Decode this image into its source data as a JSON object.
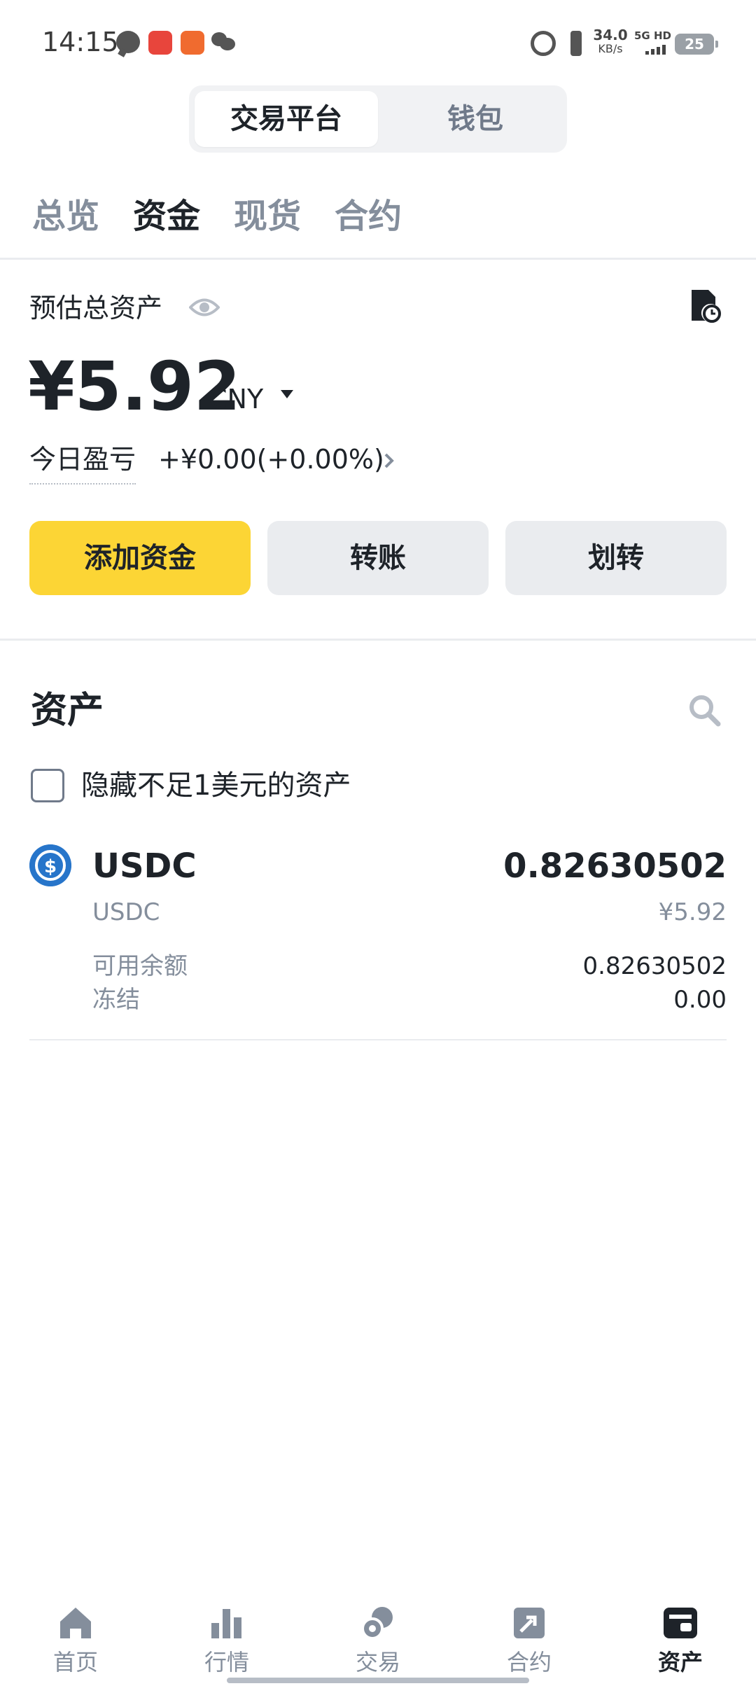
{
  "status_bar": {
    "time": "14:15",
    "net_speed_value": "34.0",
    "net_speed_unit": "KB/s",
    "signal_label": "5G HD",
    "battery": "25"
  },
  "segment": {
    "active": "交易平台",
    "inactive": "钱包"
  },
  "tabs": [
    "总览",
    "资金",
    "现货",
    "合约"
  ],
  "summary": {
    "label": "预估总资产",
    "balance": "¥5.92",
    "currency": "CNY",
    "pnl_label": "今日盈亏",
    "pnl_value": "+¥0.00(+0.00%)"
  },
  "actions": {
    "add_funds": "添加资金",
    "transfer": "转账",
    "move": "划转"
  },
  "assets": {
    "title": "资产",
    "hide_small_label": "隐藏不足1美元的资产",
    "hide_small_checked": false,
    "items": [
      {
        "symbol": "USDC",
        "name": "USDC",
        "quantity": "0.82630502",
        "value": "¥5.92",
        "available_label": "可用余额",
        "available_value": "0.82630502",
        "frozen_label": "冻结",
        "frozen_value": "0.00"
      }
    ]
  },
  "bottom_nav": {
    "items": [
      {
        "label": "首页",
        "icon": "home-icon"
      },
      {
        "label": "行情",
        "icon": "markets-icon"
      },
      {
        "label": "交易",
        "icon": "trade-icon"
      },
      {
        "label": "合约",
        "icon": "futures-icon"
      },
      {
        "label": "资产",
        "icon": "wallet-icon"
      }
    ],
    "active_index": 4
  },
  "colors": {
    "brand_yellow": "#fcd535",
    "text_primary": "#1e2329",
    "text_secondary": "#848e9c",
    "usdc_blue": "#2775ca"
  }
}
